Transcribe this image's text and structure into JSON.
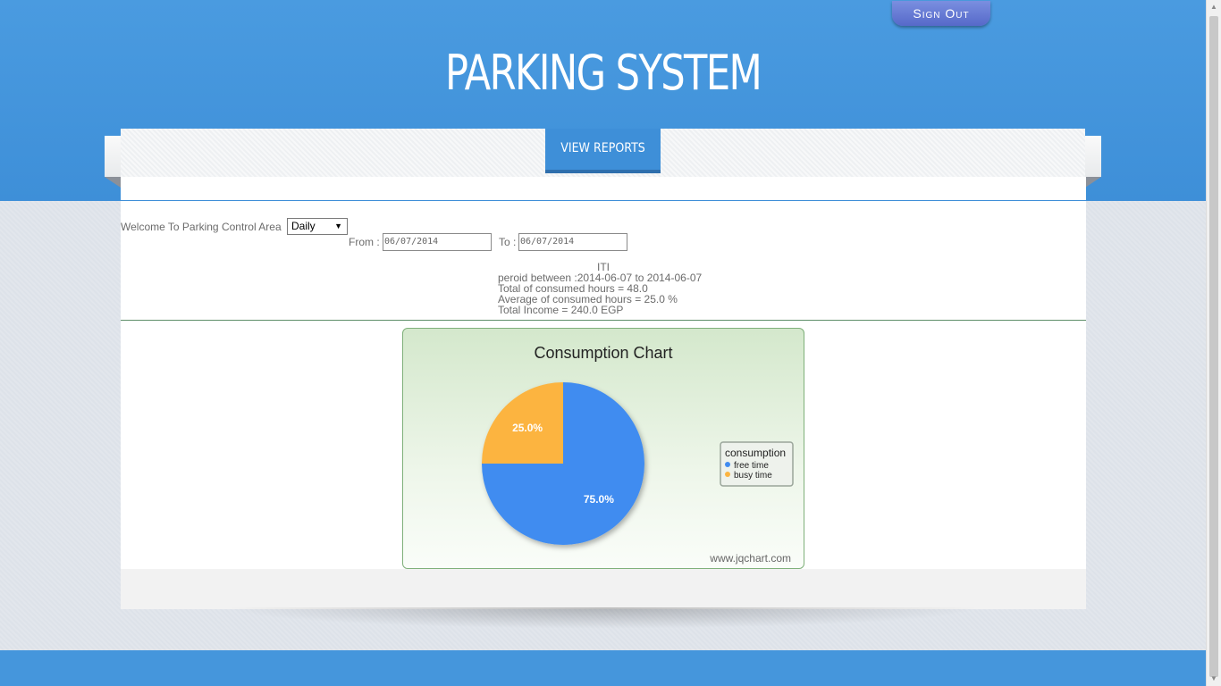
{
  "header": {
    "sign_out_label": "Sign Out",
    "site_title": "PARKING SYSTEM"
  },
  "nav": {
    "view_reports_label": "VIEW REPORTS"
  },
  "filters": {
    "welcome_label": "Welcome To Parking Control Area",
    "period_selected": "Daily",
    "from_label": "From :",
    "from_value": "06/07/2014",
    "to_label": "To :",
    "to_value": "06/07/2014"
  },
  "report": {
    "area_name": "ITI",
    "period_line": "peroid between :2014-06-07 to 2014-06-07",
    "total_hours_line": "Total of consumed hours = 48.0",
    "average_line": "Average of consumed hours = 25.0 %",
    "income_line": "Total Income = 240.0 EGP"
  },
  "chart_data": {
    "type": "pie",
    "title": "Consumption Chart",
    "legend_title": "consumption",
    "legend_position": "right",
    "categories": [
      "free time",
      "busy time"
    ],
    "values": [
      75.0,
      25.0
    ],
    "labels": [
      "75.0%",
      "25.0%"
    ],
    "colors": [
      "#418CF0",
      "#FCB441"
    ],
    "watermark": "www.jqchart.com"
  },
  "colors": {
    "header_blue": "#4a9be0",
    "signout_purple": "#5669c9"
  }
}
